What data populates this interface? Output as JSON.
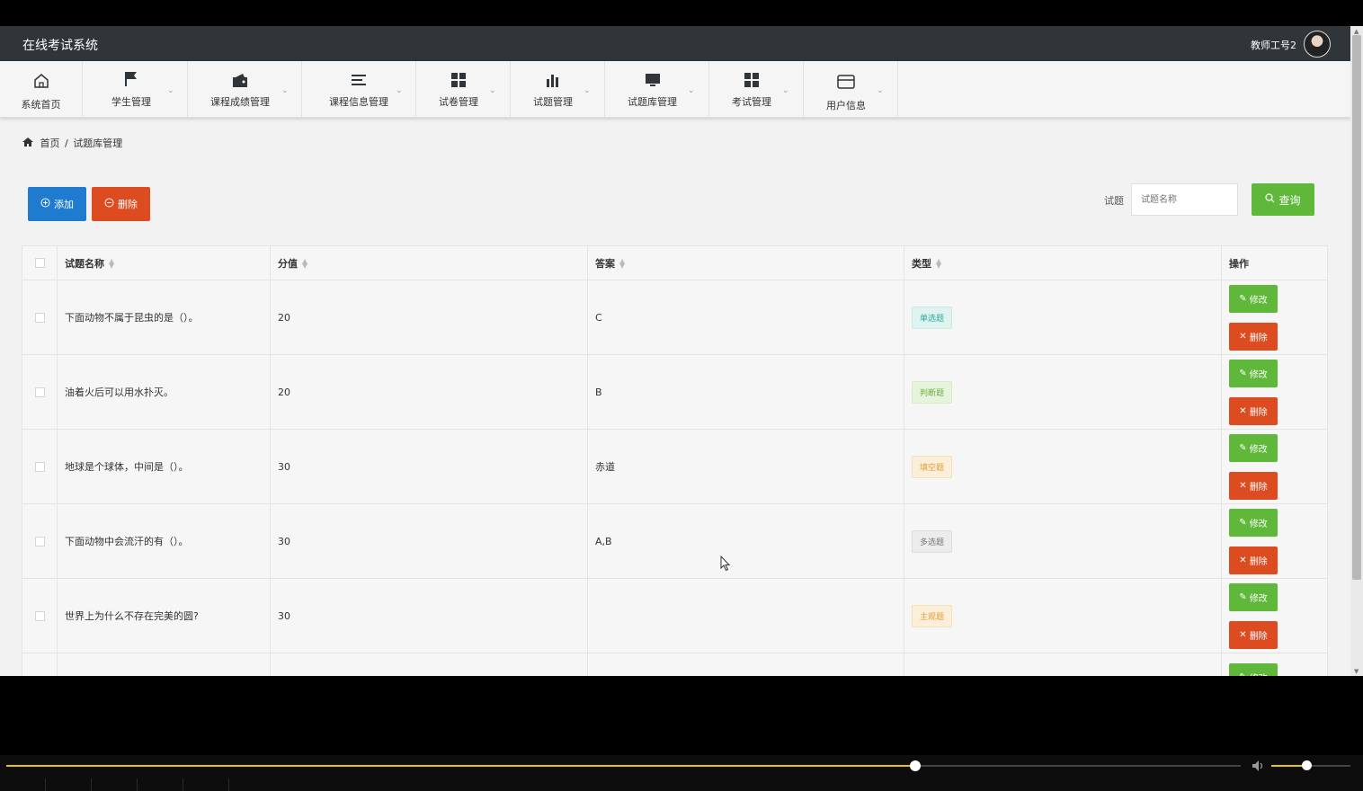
{
  "header": {
    "app_title": "在线考试系统",
    "user_name": "教师工号2"
  },
  "nav": [
    {
      "label": "系统首页",
      "icon": "home-icon"
    },
    {
      "label": "学生管理",
      "icon": "flag-icon"
    },
    {
      "label": "课程成绩管理",
      "icon": "wallet-icon"
    },
    {
      "label": "课程信息管理",
      "icon": "list-icon"
    },
    {
      "label": "试卷管理",
      "icon": "grid-icon"
    },
    {
      "label": "试题管理",
      "icon": "bar-chart-icon"
    },
    {
      "label": "试题库管理",
      "icon": "monitor-icon"
    },
    {
      "label": "考试管理",
      "icon": "grid-icon"
    },
    {
      "label": "用户信息",
      "icon": "card-icon"
    }
  ],
  "breadcrumb": {
    "home": "首页",
    "separator": "/",
    "current": "试题库管理"
  },
  "toolbar": {
    "add_label": "添加",
    "delete_label": "删除",
    "search_label": "试题",
    "search_placeholder": "试题名称",
    "query_label": "查询"
  },
  "table": {
    "headers": [
      "试题名称",
      "分值",
      "答案",
      "类型",
      "操作"
    ],
    "rows": [
      {
        "name": "下面动物不属于昆虫的是（）。",
        "score": "20",
        "answer": "C",
        "type": "单选题"
      },
      {
        "name": "油着火后可以用水扑灭。",
        "score": "20",
        "answer": "B",
        "type": "判断题"
      },
      {
        "name": "地球是个球体，中间是（）。",
        "score": "30",
        "answer": "赤道",
        "type": "填空题"
      },
      {
        "name": "下面动物中会流汗的有（）。",
        "score": "30",
        "answer": "A,B",
        "type": "多选题"
      },
      {
        "name": "世界上为什么不存在完美的圆?",
        "score": "30",
        "answer": "",
        "type": "主观题"
      }
    ],
    "edit_label": "修改",
    "delete_label": "删除"
  },
  "player": {
    "progress": 0.736,
    "volume": 0.44
  },
  "colors": {
    "header_bg": "#2f3538",
    "primary": "#1e7bd0",
    "danger": "#dd4b21",
    "success": "#5fb83a",
    "progress": "#e6c21d"
  }
}
